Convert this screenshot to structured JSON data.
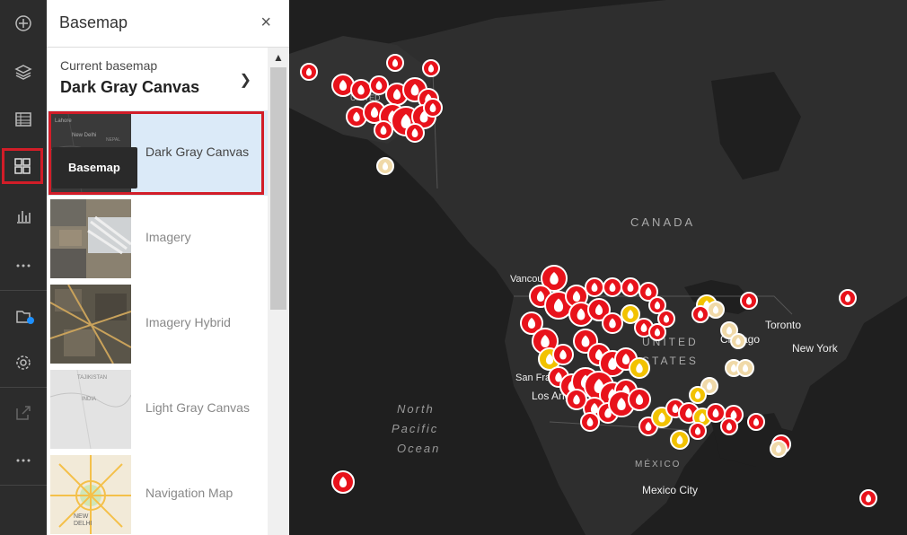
{
  "toolbar": {
    "items": [
      {
        "name": "add-icon"
      },
      {
        "name": "layers-icon"
      },
      {
        "name": "table-icon"
      },
      {
        "name": "basemap-gallery-icon"
      },
      {
        "name": "chart-icon"
      },
      {
        "name": "more-icon"
      },
      {
        "name": "save-icon"
      },
      {
        "name": "settings-icon"
      },
      {
        "name": "share-icon"
      },
      {
        "name": "more-icon"
      }
    ],
    "active_color": "#d21d28",
    "notification_color": "#1e90ff"
  },
  "tooltip": {
    "text": "Basemap"
  },
  "panel": {
    "title": "Basemap",
    "close_symbol": "×",
    "current_label": "Current basemap",
    "current_value": "Dark Gray Canvas",
    "items": [
      {
        "label": "Dark Gray Canvas"
      },
      {
        "label": "Imagery"
      },
      {
        "label": "Imagery Hybrid"
      },
      {
        "label": "Light Gray Canvas"
      },
      {
        "label": "Navigation Map"
      }
    ],
    "thumb_text": {
      "dark": [
        "Lahore",
        "New Delhi",
        "NEPAL"
      ],
      "lightgray": [
        "TAJIKISTAN",
        "INDIA"
      ],
      "nav": [
        "NEW",
        "DELHI"
      ]
    }
  },
  "map": {
    "labels": {
      "canada": "CANADA",
      "united_states_alaska": "UNITED STATES",
      "united_states": "UNITED STATES",
      "mexico": "MÉXICO",
      "vancouver": "Vancouver",
      "san_francisco": "San Francisco",
      "los_angeles": "Los Angeles",
      "chicago": "Chicago",
      "toronto": "Toronto",
      "new_york": "New York",
      "mexico_city": "Mexico City",
      "ocean": "North Pacific Ocean"
    },
    "colors": {
      "fire_red": "#e8121b",
      "fire_yellow": "#f2c200",
      "fire_beige": "#f0d9a8",
      "land": "#2e2e2e",
      "water": "#1f1f1f"
    }
  }
}
